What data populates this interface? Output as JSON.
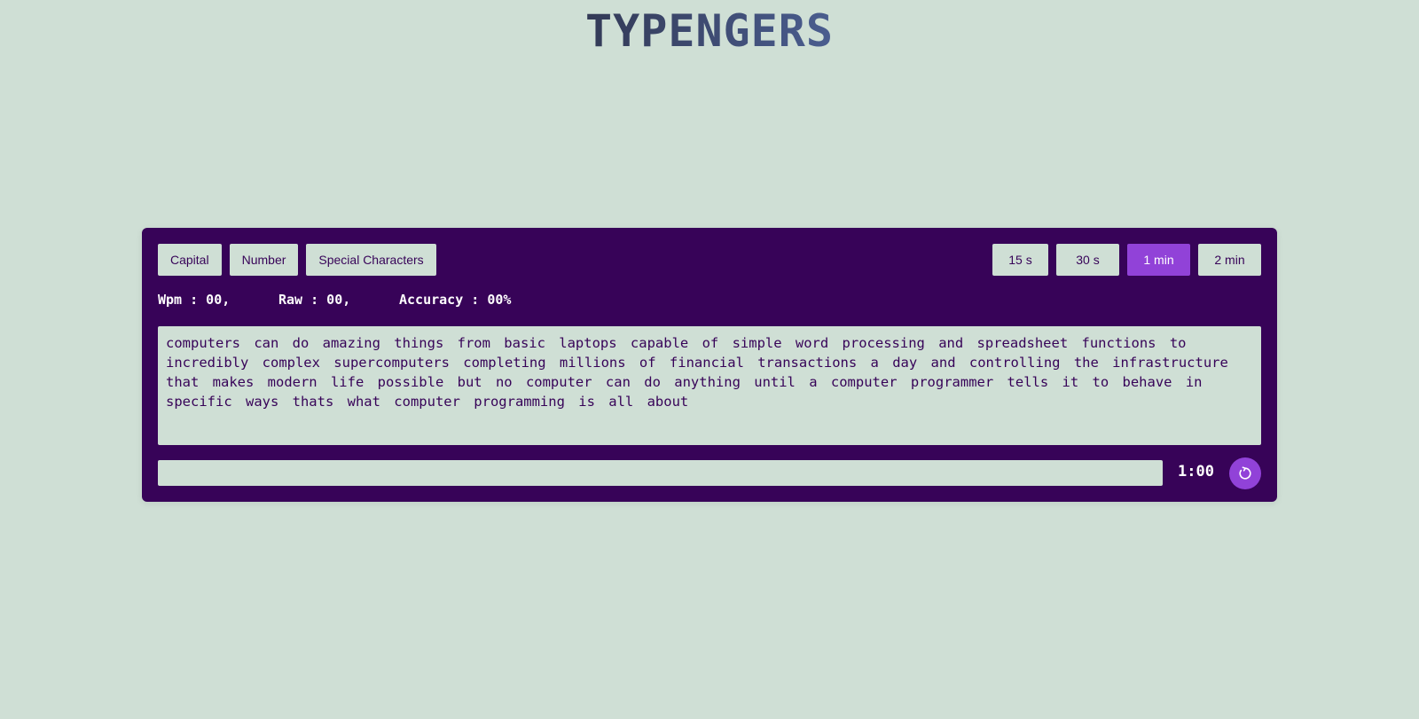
{
  "logo": {
    "text": "TYPENGERS",
    "color_dark": "#333a56",
    "color_light": "#4a5d8f"
  },
  "options": {
    "capital_label": "Capital",
    "number_label": "Number",
    "special_label": "Special Characters"
  },
  "time_options": {
    "t15_label": "15 s",
    "t30_label": "30 s",
    "t60_label": "1 min",
    "t120_label": "2 min",
    "selected": "1 min"
  },
  "stats": {
    "wpm": "Wpm : 00,",
    "raw": "Raw : 00,",
    "accuracy": "Accuracy : 00%"
  },
  "passage": {
    "text": "computers can do amazing things from basic laptops capable of simple word processing and spreadsheet functions to incredibly complex supercomputers completing millions of financial transactions a day and controlling the infrastructure that makes modern life possible but no computer can do anything until a computer programmer tells it to behave in specific ways thats what computer programming is all about"
  },
  "input": {
    "value": "",
    "placeholder": ""
  },
  "timer": {
    "display": "1:00"
  },
  "icons": {
    "restart": "restart-icon"
  },
  "colors": {
    "background": "#cfdfd5",
    "panel": "#370358",
    "accent": "#9142d8",
    "text_on_light": "#370358",
    "text_on_dark": "#ffffff"
  }
}
